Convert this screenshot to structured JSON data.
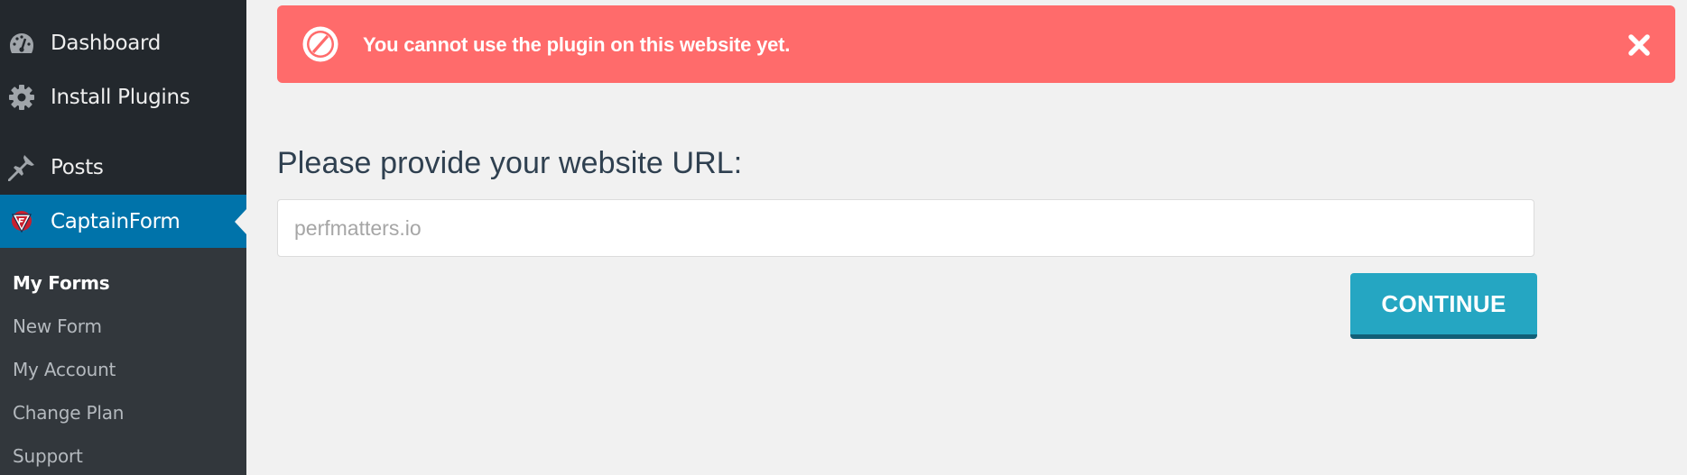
{
  "sidebar": {
    "menu": [
      {
        "label": "Dashboard",
        "icon": "dashboard-icon"
      },
      {
        "label": "Install Plugins",
        "icon": "gear-icon"
      },
      {
        "label": "Posts",
        "icon": "pushpin-icon"
      },
      {
        "label": "CaptainForm",
        "icon": "captainform-logo-icon",
        "active": true
      }
    ],
    "submenu": [
      {
        "label": "My Forms",
        "current": true
      },
      {
        "label": "New Form"
      },
      {
        "label": "My Account"
      },
      {
        "label": "Change Plan"
      },
      {
        "label": "Support"
      }
    ]
  },
  "alert": {
    "message": "You cannot use the plugin on this website yet.",
    "icon": "ban-icon",
    "close_icon": "close-icon",
    "color": "#ff6b6b"
  },
  "form": {
    "heading": "Please provide your website URL:",
    "url_placeholder": "perfmatters.io",
    "url_value": "",
    "continue_label": "CONTINUE",
    "button_color": "#25a6c2"
  },
  "colors": {
    "sidebar_bg": "#23282d",
    "submenu_bg": "#32373c",
    "active_bg": "#0073aa",
    "page_bg": "#f1f1f1"
  }
}
